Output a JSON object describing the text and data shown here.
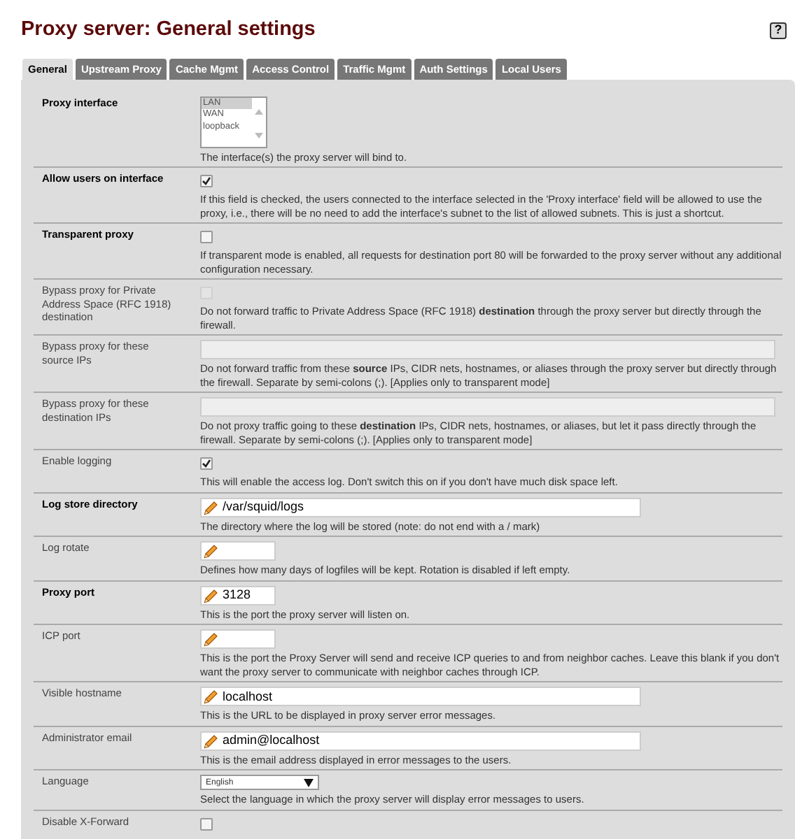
{
  "title": "Proxy server: General settings",
  "help": "?",
  "tabs": [
    {
      "label": "General",
      "selected": true
    },
    {
      "label": "Upstream Proxy",
      "selected": false
    },
    {
      "label": "Cache Mgmt",
      "selected": false
    },
    {
      "label": "Access Control",
      "selected": false
    },
    {
      "label": "Traffic Mgmt",
      "selected": false
    },
    {
      "label": "Auth Settings",
      "selected": false
    },
    {
      "label": "Local Users",
      "selected": false
    }
  ],
  "rows": [
    {
      "label": "Proxy interface",
      "required": true,
      "kind": "listbox",
      "options": [
        {
          "label": "LAN",
          "selected": true
        },
        {
          "label": "WAN",
          "selected": false
        },
        {
          "label": "loopback",
          "selected": false
        }
      ],
      "description": "The interface(s) the proxy server will bind to."
    },
    {
      "label": "Allow users on interface",
      "required": true,
      "kind": "checkbox",
      "checked": true,
      "disabled": false,
      "description": "If this field is checked, the users connected to the interface selected in the 'Proxy interface' field will be allowed to use the proxy, i.e., there will be no need to add the interface's subnet to the list of allowed subnets. This is just a shortcut."
    },
    {
      "label": "Transparent proxy",
      "required": true,
      "kind": "checkbox",
      "checked": false,
      "disabled": false,
      "description": "If transparent mode is enabled, all requests for destination port 80 will be forwarded to the proxy server without any additional configuration necessary."
    },
    {
      "label": "Bypass proxy for Private Address Space (RFC 1918) destination",
      "required": false,
      "kind": "checkbox",
      "checked": false,
      "disabled": true,
      "description": "Do not forward traffic to Private Address Space (RFC 1918) **destination** through the proxy server but directly through the firewall."
    },
    {
      "label": "Bypass proxy for these source IPs",
      "required": false,
      "kind": "address-list",
      "description": "Do not forward traffic from these **source** IPs, CIDR nets, hostnames, or aliases through the proxy server but directly through the firewall. Separate by semi-colons (;). [Applies only to transparent mode]"
    },
    {
      "label": "Bypass proxy for these destination IPs",
      "required": false,
      "kind": "address-list",
      "description": "Do not proxy traffic going to these **destination** IPs, CIDR nets, hostnames, or aliases, but let it pass directly through the firewall. Separate by semi-colons (;). [Applies only to transparent mode]"
    },
    {
      "label": "Enable logging",
      "required": false,
      "kind": "checkbox",
      "checked": true,
      "disabled": false,
      "description": "This will enable the access log. Don't switch this on if you don't have much disk space left."
    },
    {
      "label": "Log store directory",
      "required": true,
      "kind": "text",
      "value": "/var/squid/logs",
      "description": "The directory where the log will be stored (note: do not end with a / mark)"
    },
    {
      "label": "Log rotate",
      "required": false,
      "kind": "number",
      "description": "Defines how many days of logfiles will be kept. Rotation is disabled if left empty."
    },
    {
      "label": "Proxy port",
      "required": true,
      "kind": "number",
      "value": "3128",
      "description": "This is the port the proxy server will listen on."
    },
    {
      "label": "ICP port",
      "required": false,
      "kind": "number",
      "description": "This is the port the Proxy Server will send and receive ICP queries to and from neighbor caches. Leave this blank if you don't want the proxy server to communicate with neighbor caches through ICP."
    },
    {
      "label": "Visible hostname",
      "required": false,
      "kind": "text",
      "value": "localhost",
      "description": "This is the URL to be displayed in proxy server error messages."
    },
    {
      "label": "Administrator email",
      "required": false,
      "kind": "text",
      "value": "admin@localhost",
      "description": "This is the email address displayed in error messages to the users."
    },
    {
      "label": "Language",
      "required": false,
      "kind": "select",
      "value": "English",
      "description": "Select the language in which the proxy server will display error messages to users."
    },
    {
      "label": "Disable X-Forward",
      "required": false,
      "kind": "checkbox",
      "checked": false,
      "disabled": false
    }
  ]
}
